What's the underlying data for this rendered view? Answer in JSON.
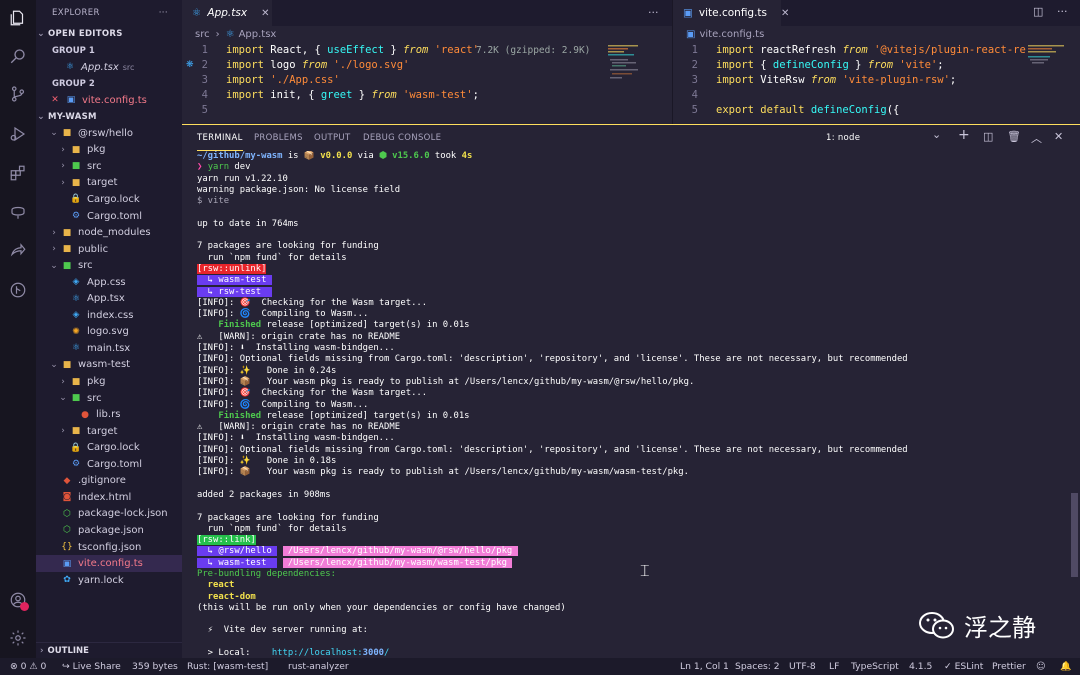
{
  "sidebar": {
    "title": "EXPLORER",
    "more": "···",
    "open_editors": "OPEN EDITORS",
    "group1": "GROUP 1",
    "group1_file": "App.tsx",
    "group1_hint": "src",
    "group2": "GROUP 2",
    "group2_file": "vite.config.ts",
    "project": "MY-WASM",
    "tree": [
      {
        "label": "@rsw/hello",
        "indent": 1,
        "type": "folder",
        "open": true
      },
      {
        "label": "pkg",
        "indent": 2,
        "type": "folder",
        "open": false
      },
      {
        "label": "src",
        "indent": 2,
        "type": "folder-src",
        "open": false
      },
      {
        "label": "target",
        "indent": 2,
        "type": "folder",
        "open": false
      },
      {
        "label": "Cargo.lock",
        "indent": 2,
        "type": "lock"
      },
      {
        "label": "Cargo.toml",
        "indent": 2,
        "type": "gear"
      },
      {
        "label": "node_modules",
        "indent": 1,
        "type": "folder",
        "open": false
      },
      {
        "label": "public",
        "indent": 1,
        "type": "folder",
        "open": false
      },
      {
        "label": "src",
        "indent": 1,
        "type": "folder-src",
        "open": true
      },
      {
        "label": "App.css",
        "indent": 2,
        "type": "css"
      },
      {
        "label": "App.tsx",
        "indent": 2,
        "type": "react"
      },
      {
        "label": "index.css",
        "indent": 2,
        "type": "css"
      },
      {
        "label": "logo.svg",
        "indent": 2,
        "type": "svg"
      },
      {
        "label": "main.tsx",
        "indent": 2,
        "type": "react"
      },
      {
        "label": "wasm-test",
        "indent": 1,
        "type": "folder",
        "open": true
      },
      {
        "label": "pkg",
        "indent": 2,
        "type": "folder",
        "open": false
      },
      {
        "label": "src",
        "indent": 2,
        "type": "folder-src",
        "open": true
      },
      {
        "label": "lib.rs",
        "indent": 3,
        "type": "rust"
      },
      {
        "label": "target",
        "indent": 2,
        "type": "folder",
        "open": false
      },
      {
        "label": "Cargo.lock",
        "indent": 2,
        "type": "lock"
      },
      {
        "label": "Cargo.toml",
        "indent": 2,
        "type": "gear"
      },
      {
        "label": ".gitignore",
        "indent": 1,
        "type": "git"
      },
      {
        "label": "index.html",
        "indent": 1,
        "type": "html"
      },
      {
        "label": "package-lock.json",
        "indent": 1,
        "type": "node"
      },
      {
        "label": "package.json",
        "indent": 1,
        "type": "node"
      },
      {
        "label": "tsconfig.json",
        "indent": 1,
        "type": "json"
      },
      {
        "label": "vite.config.ts",
        "indent": 1,
        "type": "vite",
        "selected": true
      },
      {
        "label": "yarn.lock",
        "indent": 1,
        "type": "yarn"
      }
    ],
    "outline": "OUTLINE"
  },
  "editor_left": {
    "tab": "App.tsx",
    "crumb_folder": "src",
    "crumb_file": "App.tsx",
    "size_hint": "7.2K (gzipped: 2.9K)",
    "lines": [
      {
        "n": "1",
        "parts": [
          [
            "kw",
            "import "
          ],
          [
            "pl",
            "React, { "
          ],
          [
            "fn",
            "useEffect"
          ],
          [
            "pl",
            " } "
          ],
          [
            "from",
            "from "
          ],
          [
            "str",
            "'react'"
          ]
        ]
      },
      {
        "n": "2",
        "parts": [
          [
            "kw",
            "import "
          ],
          [
            "pl",
            "logo "
          ],
          [
            "from",
            "from "
          ],
          [
            "str",
            "'./logo.svg'"
          ]
        ]
      },
      {
        "n": "3",
        "parts": [
          [
            "kw",
            "import "
          ],
          [
            "str",
            "'./App.css'"
          ]
        ]
      },
      {
        "n": "4",
        "parts": [
          [
            "kw",
            "import "
          ],
          [
            "pl",
            "init, { "
          ],
          [
            "fn",
            "greet"
          ],
          [
            "pl",
            " } "
          ],
          [
            "from",
            "from "
          ],
          [
            "str",
            "'wasm-test'"
          ],
          [
            "pl",
            ";"
          ]
        ]
      },
      {
        "n": "5",
        "parts": []
      }
    ]
  },
  "editor_right": {
    "tab": "vite.config.ts",
    "crumb_file": "vite.config.ts",
    "lines": [
      {
        "n": "1",
        "parts": [
          [
            "kw",
            "import "
          ],
          [
            "pl",
            "reactRefresh "
          ],
          [
            "from",
            "from "
          ],
          [
            "str",
            "'@vitejs/plugin-react-refre"
          ]
        ]
      },
      {
        "n": "2",
        "parts": [
          [
            "kw",
            "import "
          ],
          [
            "pl",
            "{ "
          ],
          [
            "fn",
            "defineConfig"
          ],
          [
            "pl",
            " } "
          ],
          [
            "from",
            "from "
          ],
          [
            "str",
            "'vite'"
          ],
          [
            "pl",
            ";"
          ]
        ]
      },
      {
        "n": "3",
        "parts": [
          [
            "kw",
            "import "
          ],
          [
            "pl",
            "ViteRsw "
          ],
          [
            "from",
            "from "
          ],
          [
            "str",
            "'vite-plugin-rsw'"
          ],
          [
            "pl",
            ";"
          ]
        ]
      },
      {
        "n": "4",
        "parts": []
      },
      {
        "n": "5",
        "parts": [
          [
            "kw",
            "export default "
          ],
          [
            "fn",
            "defineConfig"
          ],
          [
            "pl",
            "({"
          ]
        ]
      }
    ]
  },
  "panel": {
    "tabs": [
      "TERMINAL",
      "PROBLEMS",
      "OUTPUT",
      "DEBUG CONSOLE"
    ],
    "terminal_name": "1: node",
    "chevron": "⌄",
    "plus": "+",
    "lines": [
      [
        [
          "blue",
          "~/github/my-wasm"
        ],
        [
          "pl",
          " is 📦 "
        ],
        [
          "yel",
          "v0.0.0"
        ],
        [
          "pl",
          " via "
        ],
        [
          "grnb",
          "⬢ v15.6.0"
        ],
        [
          "pl",
          " took "
        ],
        [
          "yel",
          "4s"
        ]
      ],
      [
        [
          "pink",
          "❯ "
        ],
        [
          "grn",
          "yarn"
        ],
        [
          "pl",
          " dev"
        ]
      ],
      [
        [
          "pl",
          "yarn run v1.22.10"
        ]
      ],
      [
        [
          "pl",
          "warning package.json: No license field"
        ]
      ],
      [
        [
          "dim",
          "$ vite"
        ]
      ],
      [
        [
          "pl",
          ""
        ]
      ],
      [
        [
          "pl",
          "up to date in 764ms"
        ]
      ],
      [
        [
          "pl",
          ""
        ]
      ],
      [
        [
          "pl",
          "7 packages are looking for funding"
        ]
      ],
      [
        [
          "pl",
          "  run `npm fund` for details"
        ]
      ],
      [
        [
          "bg-red",
          "[rsw::unlink]"
        ]
      ],
      [
        [
          "bg-vio",
          "  ↳ wasm-test "
        ]
      ],
      [
        [
          "bg-vio",
          "  ↳ rsw-test  "
        ]
      ],
      [
        [
          "pl",
          "[INFO]: 🎯  Checking for the Wasm target..."
        ]
      ],
      [
        [
          "pl",
          "[INFO]: 🌀  Compiling to Wasm..."
        ]
      ],
      [
        [
          "grnb",
          "    Finished"
        ],
        [
          "pl",
          " release [optimized] target(s) in 0.01s"
        ]
      ],
      [
        [
          "pl",
          "⚠   [WARN]: origin crate has no README"
        ]
      ],
      [
        [
          "pl",
          "[INFO]: ⬇  Installing wasm-bindgen..."
        ]
      ],
      [
        [
          "pl",
          "[INFO]: Optional fields missing from Cargo.toml: 'description', 'repository', and 'license'. These are not necessary, but recommended"
        ]
      ],
      [
        [
          "pl",
          "[INFO]: ✨   Done in 0.24s"
        ]
      ],
      [
        [
          "pl",
          "[INFO]: 📦   Your wasm pkg is ready to publish at /Users/lencx/github/my-wasm/@rsw/hello/pkg."
        ]
      ],
      [
        [
          "pl",
          "[INFO]: 🎯  Checking for the Wasm target..."
        ]
      ],
      [
        [
          "pl",
          "[INFO]: 🌀  Compiling to Wasm..."
        ]
      ],
      [
        [
          "grnb",
          "    Finished"
        ],
        [
          "pl",
          " release [optimized] target(s) in 0.01s"
        ]
      ],
      [
        [
          "pl",
          "⚠   [WARN]: origin crate has no README"
        ]
      ],
      [
        [
          "pl",
          "[INFO]: ⬇  Installing wasm-bindgen..."
        ]
      ],
      [
        [
          "pl",
          "[INFO]: Optional fields missing from Cargo.toml: 'description', 'repository', and 'license'. These are not necessary, but recommended"
        ]
      ],
      [
        [
          "pl",
          "[INFO]: ✨   Done in 0.18s"
        ]
      ],
      [
        [
          "pl",
          "[INFO]: 📦   Your wasm pkg is ready to publish at /Users/lencx/github/my-wasm/wasm-test/pkg."
        ]
      ],
      [
        [
          "pl",
          ""
        ]
      ],
      [
        [
          "pl",
          "added 2 packages in 908ms"
        ]
      ],
      [
        [
          "pl",
          ""
        ]
      ],
      [
        [
          "pl",
          "7 packages are looking for funding"
        ]
      ],
      [
        [
          "pl",
          "  run `npm fund` for details"
        ]
      ],
      [
        [
          "bg-grn",
          "[rsw::link]"
        ]
      ],
      [
        [
          "bg-vio",
          "  ↳ @rsw/hello "
        ],
        [
          "pl",
          " "
        ],
        [
          "bg-pnk",
          " /Users/lencx/github/my-wasm/@rsw/hello/pkg "
        ]
      ],
      [
        [
          "bg-vio",
          "  ↳ wasm-test  "
        ],
        [
          "pl",
          " "
        ],
        [
          "bg-pnk",
          " /Users/lencx/github/my-wasm/wasm-test/pkg "
        ]
      ],
      [
        [
          "grn",
          "Pre-bundling dependencies:"
        ]
      ],
      [
        [
          "yel",
          "  react"
        ]
      ],
      [
        [
          "yel",
          "  react-dom"
        ]
      ],
      [
        [
          "pl",
          "(this will be run only when your dependencies or config have changed)"
        ]
      ],
      [
        [
          "pl",
          ""
        ]
      ],
      [
        [
          "pl",
          "  ⚡  Vite dev server running at:"
        ]
      ],
      [
        [
          "pl",
          ""
        ]
      ],
      [
        [
          "pl",
          "  > Local:    "
        ],
        [
          "cyan",
          "http://localhost:"
        ],
        [
          "blue",
          "3000"
        ],
        [
          "cyan",
          "/"
        ]
      ]
    ]
  },
  "watermark": "浮之静",
  "status": {
    "problems": "⊗ 0 ⚠ 0",
    "live_share": "Live Share",
    "size": "359 bytes",
    "rust": "Rust: [wasm-test]",
    "analyzer": "rust-analyzer",
    "position": "Ln 1, Col 1",
    "spaces": "Spaces: 2",
    "encoding": "UTF-8",
    "eol": "LF",
    "lang": "TypeScript",
    "version": "4.1.5",
    "eslint": "✓ ESLint",
    "prettier": "Prettier"
  },
  "colors": {
    "accent": "#fede5d",
    "background": "#262335",
    "sidebar": "#1e1b2e",
    "activity": "#171520"
  }
}
